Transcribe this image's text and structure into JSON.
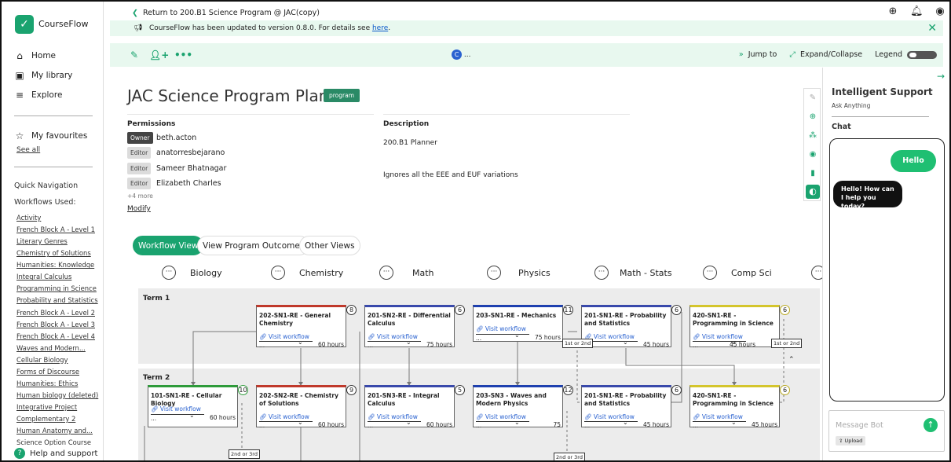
{
  "app": {
    "name": "CourseFlow",
    "logo_glyph": "✓"
  },
  "sidebar": {
    "nav": [
      {
        "label": "Home",
        "icon": "home-icon",
        "glyph": "⌂"
      },
      {
        "label": "My library",
        "icon": "library-icon",
        "glyph": "▣"
      },
      {
        "label": "Explore",
        "icon": "explore-icon",
        "glyph": "≡"
      }
    ],
    "favourites": {
      "label": "My favourites",
      "icon": "star-icon",
      "glyph": "☆",
      "see_all": "See all"
    },
    "quick_nav": "Quick Navigation",
    "workflows_used": "Workflows Used:",
    "workflows": [
      "Activity",
      "French Block A - Level 1",
      "Literary Genres",
      "Chemistry of Solutions",
      "Humanities: Knowledge",
      "Integral Calculus",
      "Programming in Science",
      "Probability and Statistics",
      "French Block A - Level 2",
      "French Block A - Level 3",
      "French Block A - Level 4",
      "Waves and Modern...",
      "Cellular Biology",
      "Forms of Discourse",
      "Humanities: Ethics",
      "Human biology (deleted)",
      "Integrative Project",
      "Complementary 2",
      "Human Anatomy and...",
      "Science Option Course"
    ],
    "help": "Help and support"
  },
  "topbar": {
    "return": "Return to 200.B1 Science Program @ JAC(copy)"
  },
  "banner": {
    "text": "CourseFlow has been updated to version 0.8.0. For details see ",
    "link": "here",
    "end": "."
  },
  "toolbar": {
    "user_initial": "C",
    "user_ellipsis": "...",
    "jump_to": "Jump to",
    "expand_collapse": "Expand/Collapse",
    "legend": "Legend"
  },
  "project": {
    "title": "JAC Science Program Planner",
    "badge": "program",
    "permissions_label": "Permissions",
    "permissions": [
      {
        "role": "Owner",
        "name": "beth.acton"
      },
      {
        "role": "Editor",
        "name": "anatorresbejarano"
      },
      {
        "role": "Editor",
        "name": "Sameer Bhatnagar"
      },
      {
        "role": "Editor",
        "name": "Elizabeth Charles"
      }
    ],
    "more": "+4 more",
    "modify": "Modify",
    "description_label": "Description",
    "description_1": "200.B1 Planner",
    "description_2": "Ignores all the EEE and EUF variations"
  },
  "view_tabs": [
    "Workflow View",
    "View Program Outcomes",
    "Other Views"
  ],
  "columns": [
    "Biology",
    "Chemistry",
    "Math",
    "Physics",
    "Math - Stats",
    "Comp Sci"
  ],
  "terms": [
    {
      "label": "Term 1",
      "nodes": [
        {
          "title": "202-SN1-RE - General Chemistry",
          "hours": "60 hours",
          "count": "8",
          "color": "#c0392b",
          "visit": "Visit workflow"
        },
        {
          "title": "201-SN2-RE - Differential Calculus",
          "hours": "75 hours",
          "count": "6",
          "color": "#3949ab",
          "visit": "Visit workflow"
        },
        {
          "title": "203-SN1-RE - Mechanics",
          "hours": "75 hours",
          "count": "11",
          "color": "#1e40af",
          "visit": "Visit workflow"
        },
        {
          "title": "201-SN1-RE - Probability and Statistics",
          "hours": "45 hours",
          "count": "6",
          "color": "#3949ab",
          "visit": "Visit workflow"
        },
        {
          "title": "420-SN1-RE - Programming in Science",
          "hours": "45 hours",
          "count": "6",
          "color": "#d4c52c",
          "visit": "Visit workflow"
        }
      ],
      "tags": [
        "1st or 2nd",
        "1st or 2nd"
      ]
    },
    {
      "label": "Term 2",
      "nodes": [
        {
          "title": "101-SN1-RE - Cellular Biology",
          "hours": "60 hours",
          "count": "10",
          "color": "#2e9b3a",
          "visit": "Visit workflow"
        },
        {
          "title": "202-SN2-RE - Chemistry of Solutions",
          "hours": "60 hours",
          "count": "9",
          "color": "#c0392b",
          "visit": "Visit workflow"
        },
        {
          "title": "201-SN3-RE - Integral Calculus",
          "hours": "60 hours",
          "count": "5",
          "color": "#3949ab",
          "visit": "Visit workflow"
        },
        {
          "title": "203-SN3 - Waves and Modern Physics",
          "hours": "75",
          "count": "12",
          "color": "#1e40af",
          "visit": "Visit workflow"
        },
        {
          "title": "201-SN1-RE - Probability and Statistics",
          "hours": "45 hours",
          "count": "6",
          "color": "#3949ab",
          "visit": "Visit workflow"
        },
        {
          "title": "420-SN1-RE - Programming in Science",
          "hours": "45 hours",
          "count": "6",
          "color": "#d4c52c",
          "visit": "Visit workflow"
        }
      ],
      "tags": [
        "2nd or 3rd",
        "2nd or 3rd"
      ]
    }
  ],
  "node_menu": "...",
  "assistant": {
    "title": "Intelligent Support",
    "subtitle": "Ask Anything",
    "chat_label": "Chat",
    "user_msg": "Hello",
    "bot_msg": "Hello! How can I help you today?",
    "placeholder": "Message Bot",
    "upload": "⇪ Upload"
  },
  "colors": {
    "accent": "#1aa36f",
    "banner_bg": "#e8f8ef",
    "term_bg": "#ececec"
  }
}
